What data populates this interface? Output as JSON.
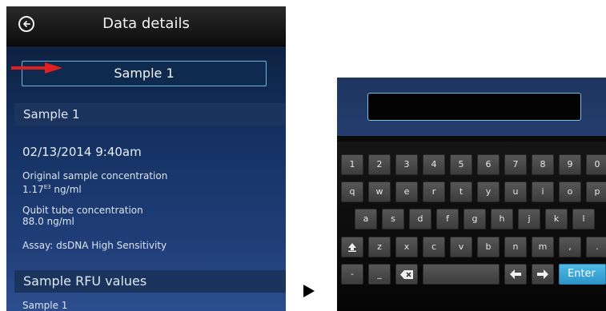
{
  "left_screen": {
    "title": "Data details",
    "sample_name_box": "Sample 1",
    "section_header_1": "Sample 1",
    "datetime": "02/13/2014 9:40am",
    "orig_label": "Original sample concentration",
    "orig_value": "1.17",
    "orig_exp": "E3",
    "orig_unit": " ng/ml",
    "qubit_label": "Qubit tube concentration",
    "qubit_value": "88.0 ng/ml",
    "assay": "Assay: dsDNA High Sensitivity",
    "section_header_2": "Sample RFU values",
    "rfu_item": "Sample 1"
  },
  "keyboard": {
    "input_value": "",
    "row1": [
      "1",
      "2",
      "3",
      "4",
      "5",
      "6",
      "7",
      "8",
      "9",
      "0"
    ],
    "row2": [
      "q",
      "w",
      "e",
      "r",
      "t",
      "y",
      "u",
      "i",
      "o",
      "p"
    ],
    "row3": [
      "a",
      "s",
      "d",
      "f",
      "g",
      "h",
      "j",
      "k",
      "l"
    ],
    "row4": [
      "z",
      "x",
      "c",
      "v",
      "b",
      "n",
      "m",
      ",",
      "."
    ],
    "dash_key": "-",
    "underscore_key": "_",
    "enter_key": "Enter",
    "shift_icon": "shift-up-arrow",
    "backspace_icon": "backspace-x",
    "left_icon": "left-arrow",
    "right_icon": "right-arrow"
  },
  "colors": {
    "input_border": "#6fc3e8",
    "enter_key": "#4fb9e6",
    "annotation_arrow": "#e02020"
  }
}
